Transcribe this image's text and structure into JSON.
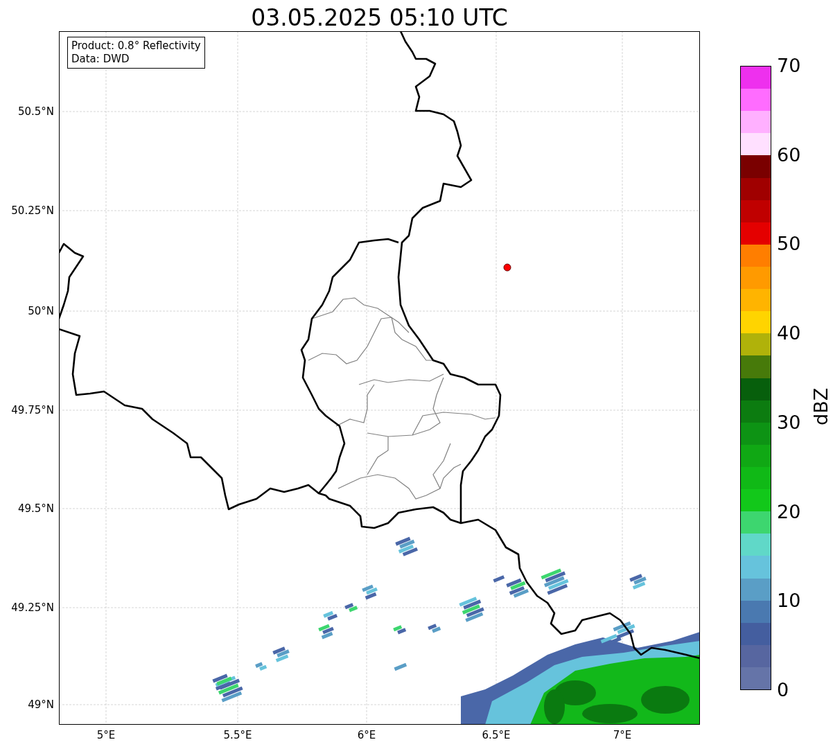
{
  "title": "03.05.2025 05:10 UTC",
  "info_box": {
    "lines": [
      "Product: 0.8° Reflectivity",
      "Data: DWD"
    ]
  },
  "y_ticks": [
    "50.5°N",
    "50.25°N",
    "50°N",
    "49.75°N",
    "49.5°N",
    "49.25°N",
    "49°N"
  ],
  "x_ticks": [
    "5°E",
    "5.5°E",
    "6°E",
    "6.5°E",
    "7°E"
  ],
  "colorbar": {
    "label": "dBZ",
    "segments": [
      {
        "color": "#ee30ee"
      },
      {
        "color": "#ff6cff"
      },
      {
        "color": "#ffb0ff"
      },
      {
        "color": "#ffe0ff"
      },
      {
        "color": "#7a0000"
      },
      {
        "color": "#a00000"
      },
      {
        "color": "#c00000"
      },
      {
        "color": "#e40000"
      },
      {
        "color": "#ff7e00"
      },
      {
        "color": "#ff9a00"
      },
      {
        "color": "#ffb400"
      },
      {
        "color": "#ffd400"
      },
      {
        "color": "#b0b20a"
      },
      {
        "color": "#477a0a"
      },
      {
        "color": "#075f0c"
      },
      {
        "color": "#0c7c10"
      },
      {
        "color": "#0d9314"
      },
      {
        "color": "#10a814"
      },
      {
        "color": "#10b916"
      },
      {
        "color": "#12c81a"
      },
      {
        "color": "#3dd66f"
      },
      {
        "color": "#60d8c8"
      },
      {
        "color": "#66c3dc"
      },
      {
        "color": "#5a9ec6"
      },
      {
        "color": "#4a79b0"
      },
      {
        "color": "#445e9f"
      },
      {
        "color": "#5766a0"
      },
      {
        "color": "#6574a8"
      }
    ],
    "ticks": [
      "70",
      "60",
      "50",
      "40",
      "30",
      "20",
      "10",
      "0"
    ]
  }
}
